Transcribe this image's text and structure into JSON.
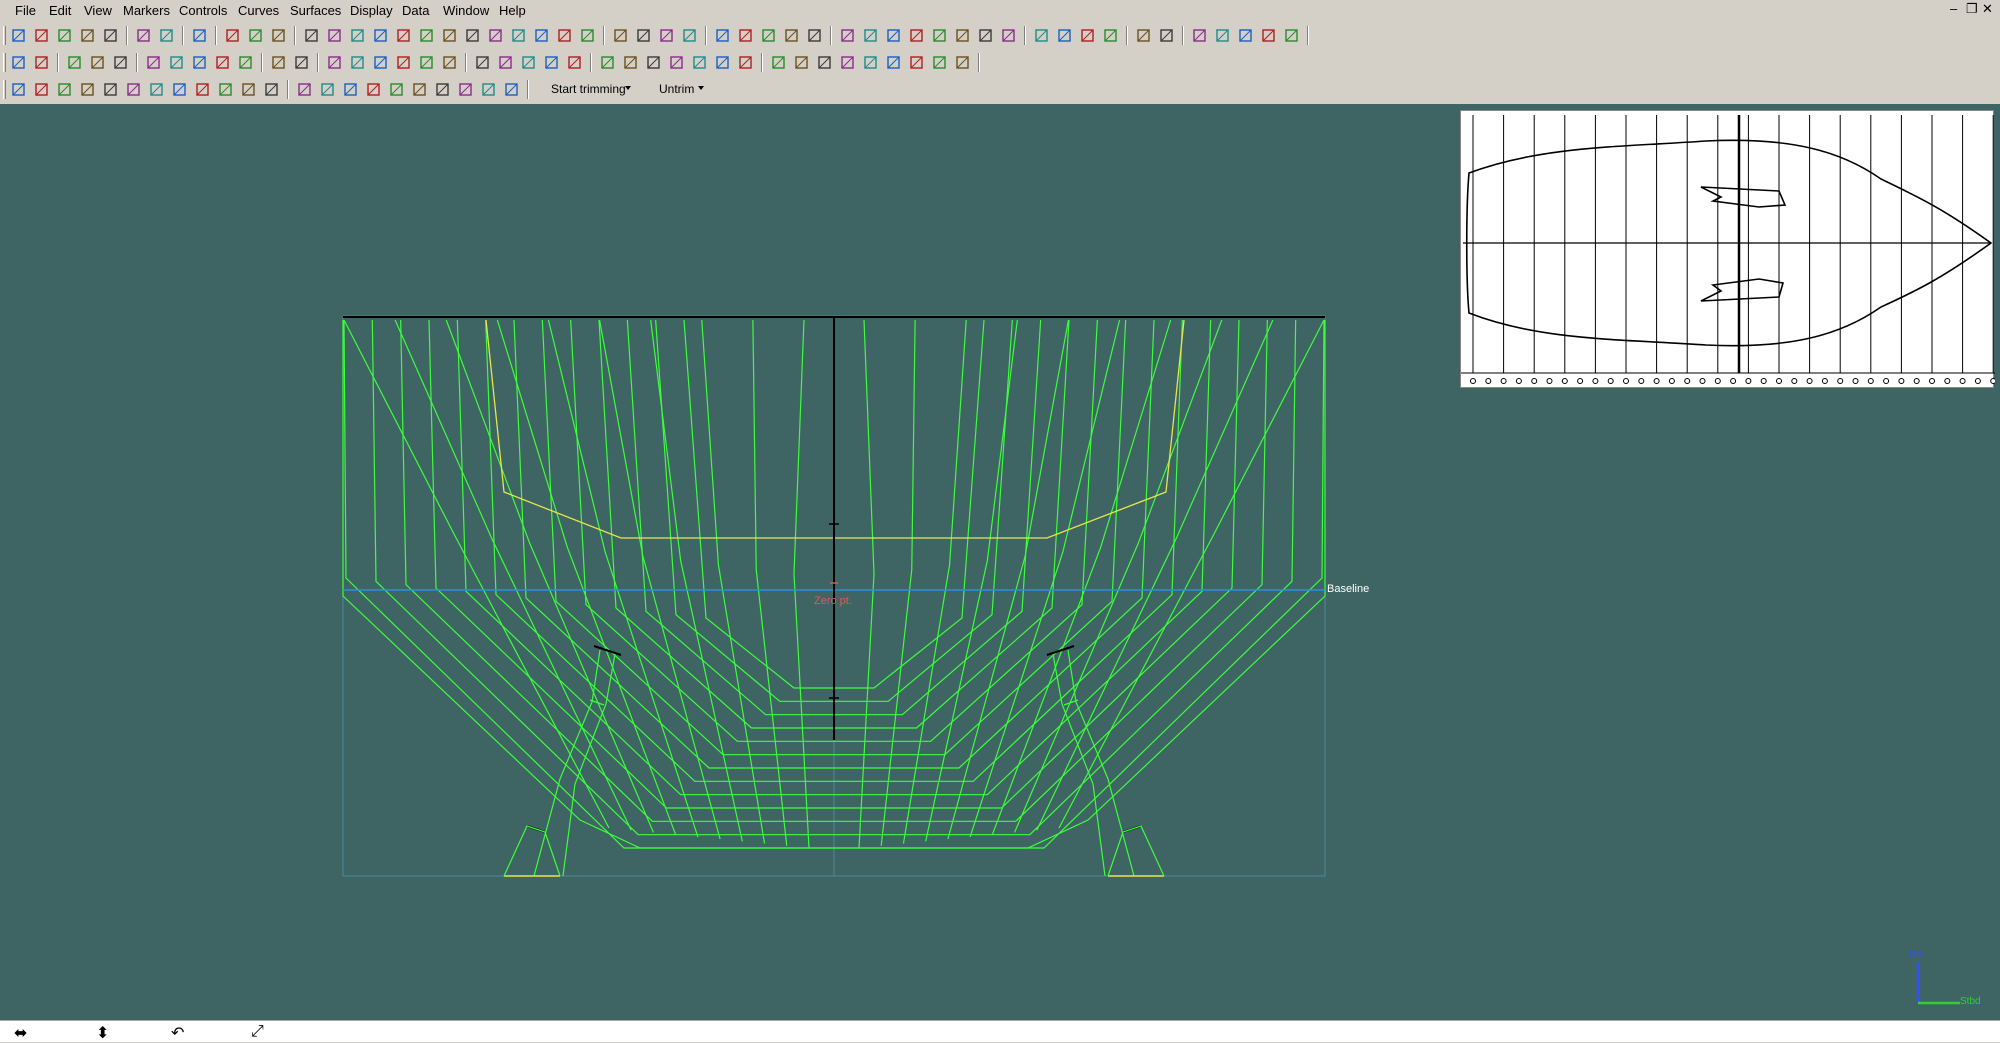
{
  "menu": [
    "File",
    "Edit",
    "View",
    "Markers",
    "Controls",
    "Curves",
    "Surfaces",
    "Display",
    "Data",
    "Window",
    "Help"
  ],
  "window_controls": {
    "minimize": "–",
    "restore": "❐",
    "close": "✕"
  },
  "toolbar": {
    "start_trimming": "Start trimming",
    "untrim": "Untrim"
  },
  "viewport": {
    "zero_point_label": "Zero pt.",
    "baseline_label": "Baseline",
    "axis_up_label": "Up",
    "axis_stbd_label": "Stbd"
  },
  "colors": {
    "viewport_bg": "#3f6464",
    "hull_lines": "#3bff3b",
    "highlight": "#e6e64c",
    "centerline": "#000000",
    "baseline": "#2f8fd8",
    "zero_point": "#e05a4a"
  },
  "statusbar": {
    "icons": [
      "pan-horizontal-icon",
      "pan-vertical-icon",
      "rotate-icon",
      "zoom-extents-icon"
    ]
  }
}
